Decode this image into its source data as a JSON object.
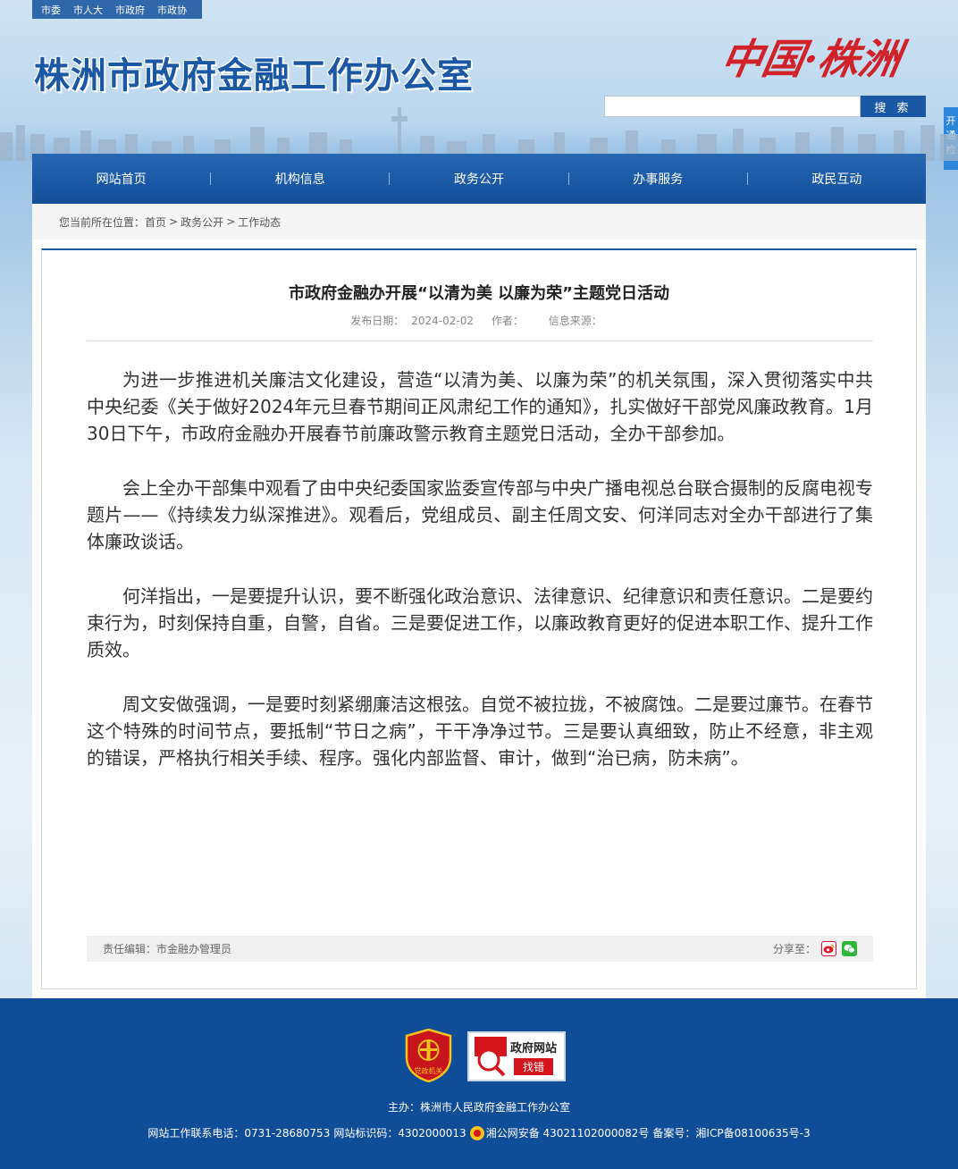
{
  "topnav": [
    "市委",
    "市人大",
    "市政府",
    "市政协"
  ],
  "header": {
    "site_title": "株洲市政府金融工作办公室",
    "logo_text": "中国·株洲"
  },
  "search": {
    "placeholder": "",
    "button_label": "搜 索"
  },
  "side_tab": "开通检",
  "nav": [
    "网站首页",
    "机构信息",
    "政务公开",
    "办事服务",
    "政民互动"
  ],
  "breadcrumb": {
    "prefix": "您当前所在位置：",
    "items": [
      "首页",
      "政务公开",
      "工作动态"
    ],
    "separator": ">"
  },
  "article": {
    "title": "市政府金融办开展“以清为美 以廉为荣”主题党日活动",
    "date_label": "发布日期：",
    "date": "2024-02-02",
    "author_label": "作者：",
    "author": "",
    "source_label": "信息来源：",
    "source": "",
    "paragraphs": [
      "为进一步推进机关廉洁文化建设，营造“以清为美、以廉为荣”的机关氛围，深入贯彻落实中共中央纪委《关于做好2024年元旦春节期间正风肃纪工作的通知》，扎实做好干部党风廉政教育。1月30日下午，市政府金融办开展春节前廉政警示教育主题党日活动，全办干部参加。",
      "会上全办干部集中观看了由中央纪委国家监委宣传部与中央广播电视总台联合摄制的反腐电视专题片——《持续发力纵深推进》。观看后，党组成员、副主任周文安、何洋同志对全办干部进行了集体廉政谈话。",
      "何洋指出，一是要提升认识，要不断强化政治意识、法律意识、纪律意识和责任意识。二是要约束行为，时刻保持自重，自警，自省。三是要促进工作，以廉政教育更好的促进本职工作、提升工作质效。",
      "周文安做强调，一是要时刻紧绷廉洁这根弦。自觉不被拉拢，不被腐蚀。二是要过廉节。在春节这个特殊的时间节点，要抵制“节日之病”，干干净净过节。三是要认真细致，防止不经意，非主观的错误，严格执行相关手续、程序。强化内部监督、审计，做到“治已病，防未病”。"
    ],
    "editor_label": "责任编辑：",
    "editor": "市金融办管理员",
    "share_label": "分享至："
  },
  "footer": {
    "party_badge": "党政机关",
    "error_badge_top": "政府网站",
    "error_badge_bottom": "找错",
    "sponsor": "主办：株洲市人民政府金融工作办公室",
    "contact_label": "网站工作联系电话：",
    "phone": "0731-28680753",
    "site_id_label": "网站标识码：",
    "site_id": "4302000013",
    "police_record": "湘公网安备 43021102000082号",
    "icp_label": "备案号：",
    "icp": "湘ICP备08100635号-3"
  },
  "colors": {
    "primary": "#1a58a6",
    "footer": "#104d98",
    "accent_red": "#d6141c"
  }
}
